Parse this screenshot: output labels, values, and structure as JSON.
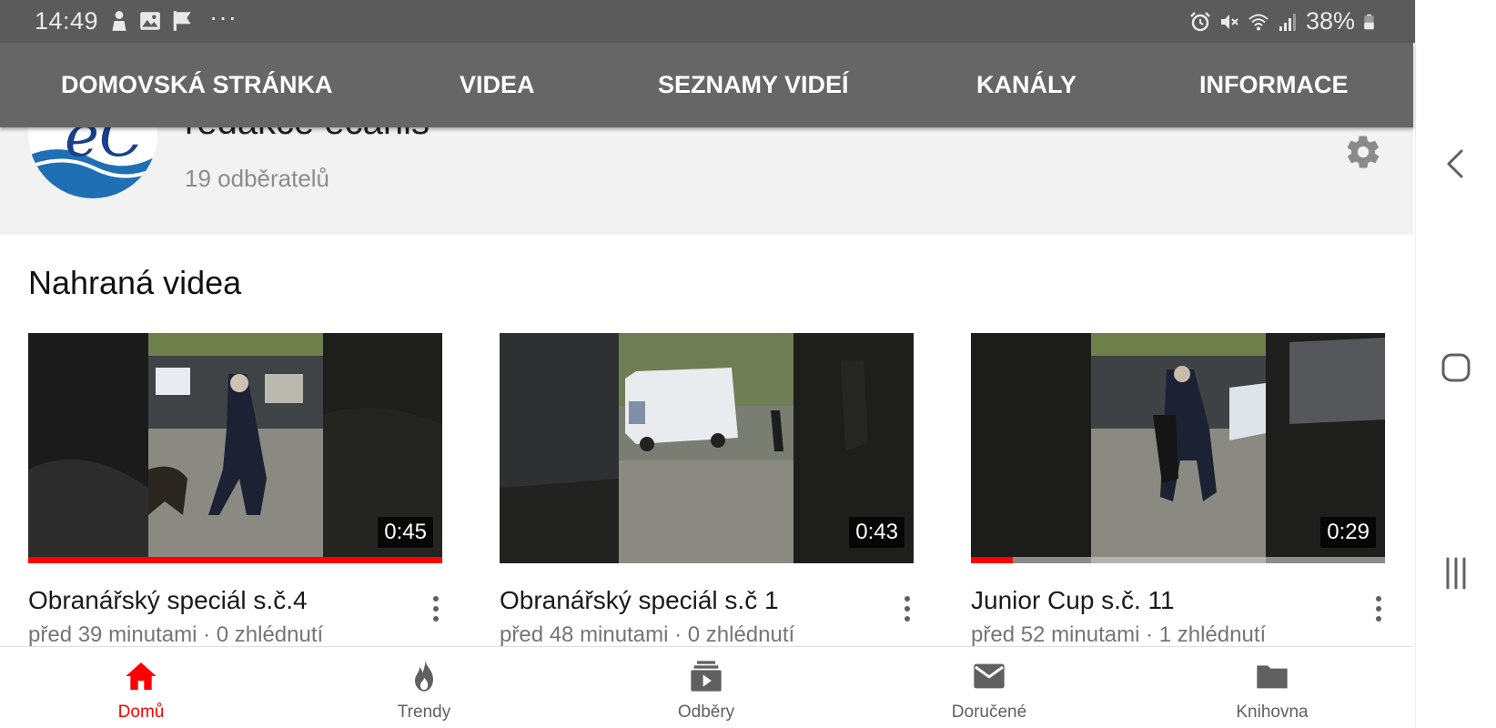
{
  "status_bar": {
    "time": "14:49",
    "left_icons": [
      "person-notification-icon",
      "image-icon",
      "flag-check-icon",
      "more-dots-icon"
    ],
    "more_glyph": "···",
    "right_icons": [
      "alarm-icon",
      "mute-icon",
      "wifi-icon",
      "signal-icon",
      "battery-icon"
    ],
    "battery": "38%"
  },
  "tabs": [
    {
      "label": "DOMOVSKÁ STRÁNKA"
    },
    {
      "label": "VIDEA"
    },
    {
      "label": "SEZNAMY VIDEÍ"
    },
    {
      "label": "KANÁLY"
    },
    {
      "label": "INFORMACE"
    }
  ],
  "channel": {
    "name": "redakce ecanis",
    "subscribers": "19 odběratelů",
    "avatar_text": "eC",
    "settings_icon": "gear-icon"
  },
  "section_title": "Nahraná videa",
  "videos": [
    {
      "title": "Obranářský speciál s.č.4",
      "meta": "před 39 minutami · 0 zhlédnutí",
      "duration": "0:45",
      "watched_progress": 1.0
    },
    {
      "title": "Obranářský speciál s.č 1",
      "meta": "před 48 minutami · 0 zhlédnutí",
      "duration": "0:43",
      "watched_progress": 0
    },
    {
      "title": "Junior Cup s.č. 11",
      "meta": "před 52 minutami · 1 zhlédnutí",
      "duration": "0:29",
      "watched_progress": 0.1
    }
  ],
  "bottom_nav": [
    {
      "label": "Domů",
      "icon": "home-icon",
      "active": true
    },
    {
      "label": "Trendy",
      "icon": "fire-icon",
      "active": false
    },
    {
      "label": "Odběry",
      "icon": "subscriptions-icon",
      "active": false
    },
    {
      "label": "Doručené",
      "icon": "mail-icon",
      "active": false
    },
    {
      "label": "Knihovna",
      "icon": "folder-icon",
      "active": false
    }
  ],
  "system_nav": [
    "back-icon",
    "home-button-icon",
    "recents-icon"
  ],
  "colors": {
    "status_bar": "#5b5b5b",
    "header": "#666666",
    "accent": "#ff0000",
    "channel_bg": "#f2f2f2"
  }
}
